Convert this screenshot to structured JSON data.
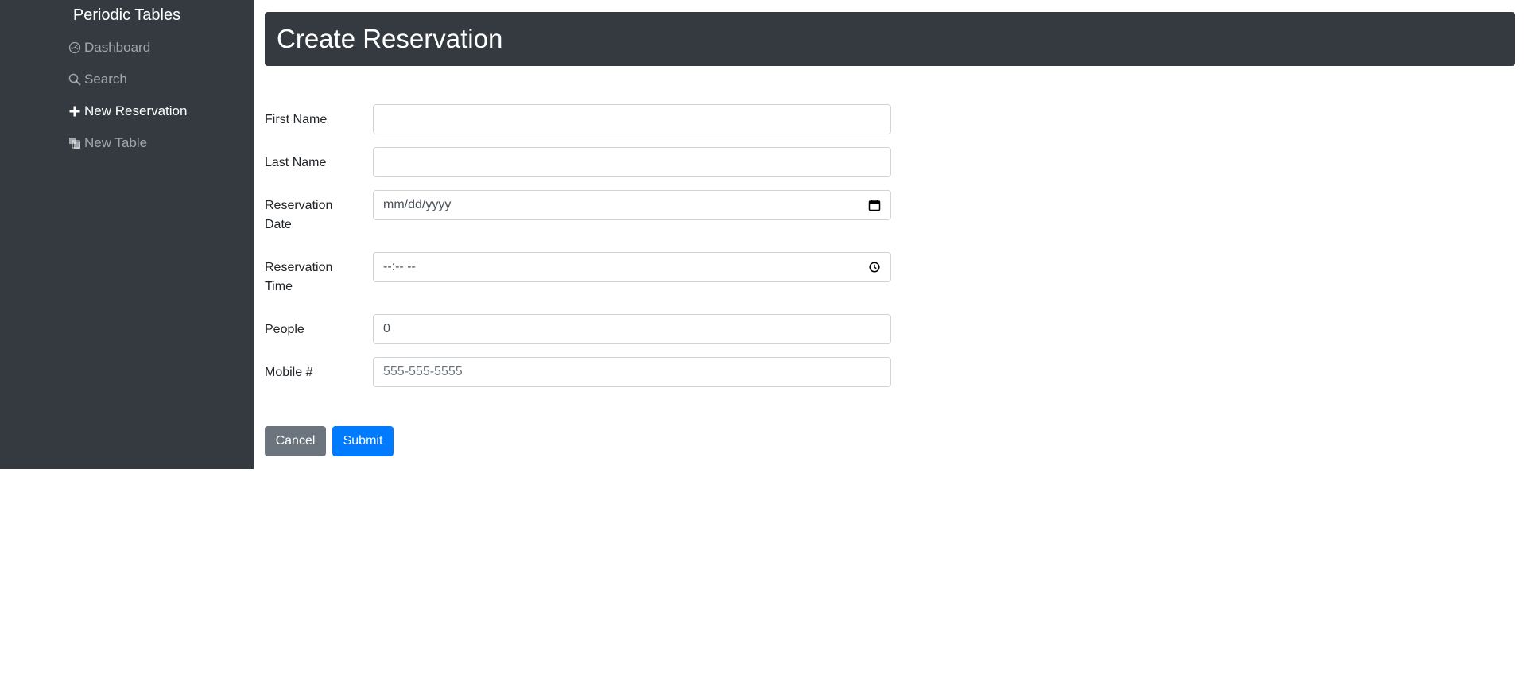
{
  "sidebar": {
    "brand": "Periodic Tables",
    "items": [
      {
        "label": "Dashboard",
        "icon": "dashboard-icon",
        "active": false
      },
      {
        "label": "Search",
        "icon": "search-icon",
        "active": false
      },
      {
        "label": "New Reservation",
        "icon": "plus-icon",
        "active": true
      },
      {
        "label": "New Table",
        "icon": "layers-icon",
        "active": false
      }
    ]
  },
  "main": {
    "title": "Create Reservation",
    "fields": [
      {
        "label": "First Name",
        "value": "",
        "placeholder": ""
      },
      {
        "label": "Last Name",
        "value": "",
        "placeholder": ""
      },
      {
        "label": "Reservation Date",
        "value": "",
        "placeholder": "mm/dd/yyyy",
        "icon": "calendar-icon"
      },
      {
        "label": "Reservation Time",
        "value": "",
        "placeholder": "--:-- --",
        "icon": "clock-icon"
      },
      {
        "label": "People",
        "value": "0",
        "placeholder": ""
      },
      {
        "label": "Mobile #",
        "value": "",
        "placeholder": "555-555-5555"
      }
    ],
    "buttons": {
      "cancel": "Cancel",
      "submit": "Submit"
    }
  },
  "colors": {
    "sidebar_bg": "#343a40",
    "header_bg": "#343a40",
    "submit": "#007bff",
    "cancel": "#6c757d"
  }
}
